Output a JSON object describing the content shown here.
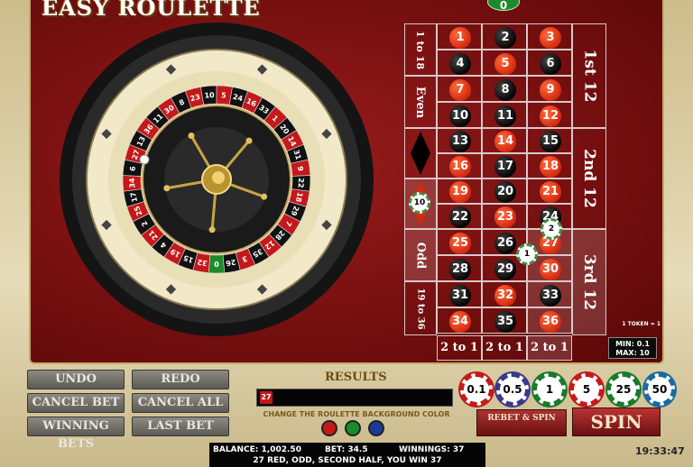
{
  "title": "EASY ROULETTE",
  "wheel_numbers": [
    "0",
    "32",
    "15",
    "19",
    "4",
    "21",
    "2",
    "25",
    "17",
    "34",
    "6",
    "27",
    "13",
    "36",
    "11",
    "30",
    "8",
    "23",
    "10",
    "5",
    "24",
    "16",
    "33",
    "1",
    "20",
    "14",
    "31",
    "9",
    "22",
    "18",
    "29",
    "7",
    "28",
    "12",
    "35",
    "3",
    "26"
  ],
  "table": {
    "zero": "0",
    "rows": [
      [
        "1",
        "2",
        "3"
      ],
      [
        "4",
        "5",
        "6"
      ],
      [
        "7",
        "8",
        "9"
      ],
      [
        "10",
        "11",
        "12"
      ],
      [
        "13",
        "14",
        "15"
      ],
      [
        "16",
        "17",
        "18"
      ],
      [
        "19",
        "20",
        "21"
      ],
      [
        "22",
        "23",
        "24"
      ],
      [
        "25",
        "26",
        "27"
      ],
      [
        "28",
        "29",
        "30"
      ],
      [
        "31",
        "32",
        "33"
      ],
      [
        "34",
        "35",
        "36"
      ]
    ],
    "red_numbers": [
      "1",
      "3",
      "5",
      "7",
      "9",
      "12",
      "14",
      "16",
      "18",
      "19",
      "21",
      "23",
      "25",
      "27",
      "30",
      "32",
      "34",
      "36"
    ],
    "outside": {
      "low": "1 to 18",
      "even": "Even",
      "odd": "Odd",
      "high": "19 to 36"
    },
    "dozens": [
      "1st 12",
      "2nd 12",
      "3rd 12"
    ],
    "columns": [
      "2 to 1",
      "2 to 1",
      "2 to 1"
    ],
    "placed_chips": [
      {
        "spot": "red",
        "label": "10"
      },
      {
        "spot": "24",
        "label": "2"
      },
      {
        "spot": "26-27-29-30",
        "label": "1"
      }
    ]
  },
  "controls": {
    "undo": "UNDO",
    "redo": "REDO",
    "cancel_bet": "CANCEL BET",
    "cancel_all": "CANCEL ALL",
    "winning_bets": "WINNING BETS",
    "last_bet": "LAST BET"
  },
  "results": {
    "label": "RESULTS",
    "history": [
      "27"
    ],
    "background_label": "CHANGE THE ROULETTE BACKGROUND COLOR",
    "bg_colors": [
      "#c8181a",
      "#1a8a2a",
      "#1a3a9a"
    ]
  },
  "chips": [
    {
      "label": "0.1",
      "color": "#c41a1a"
    },
    {
      "label": "0.5",
      "color": "#3a3a8a"
    },
    {
      "label": "1",
      "color": "#1a7a2a"
    },
    {
      "label": "5",
      "color": "#c41a1a"
    },
    {
      "label": "25",
      "color": "#1a7a2a"
    },
    {
      "label": "50",
      "color": "#1a6aa0"
    }
  ],
  "rebet_spin": "REBET & SPIN",
  "spin": "SPIN",
  "token_note": "1 TOKEN = 1",
  "limits": {
    "min": "MIN: 0.1",
    "max": "MAX: 10"
  },
  "status": {
    "balance": "BALANCE: 1,002.50",
    "bet": "BET: 34.5",
    "winnings": "WINNINGS: 37",
    "message": "27 RED, ODD, SECOND HALF, YOU WIN 37"
  },
  "clock": "19:33:47"
}
